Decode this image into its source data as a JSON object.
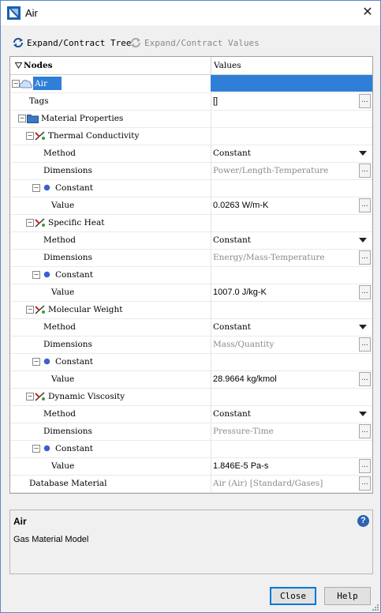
{
  "window": {
    "title": "Air",
    "close_glyph": "✕"
  },
  "toolbar": {
    "expand_tree_label": "Expand/Contract Tree",
    "expand_values_label": "Expand/Contract Values"
  },
  "grid": {
    "header": {
      "nodes": "Nodes",
      "values": "Values"
    },
    "rows": {
      "air": {
        "name": "Air",
        "value": ""
      },
      "tags": {
        "name": "Tags",
        "value": "[]",
        "button": "..."
      },
      "matprops": {
        "name": "Material Properties"
      },
      "thermal": {
        "name": "Thermal Conductivity"
      },
      "tc_method": {
        "name": "Method",
        "value": "Constant"
      },
      "tc_dims": {
        "name": "Dimensions",
        "value": "Power/Length-Temperature",
        "button": "..."
      },
      "tc_const": {
        "name": "Constant"
      },
      "tc_value": {
        "name": "Value",
        "value": "0.0263 W/m-K",
        "button": "..."
      },
      "specheat": {
        "name": "Specific Heat"
      },
      "sh_method": {
        "name": "Method",
        "value": "Constant"
      },
      "sh_dims": {
        "name": "Dimensions",
        "value": "Energy/Mass-Temperature",
        "button": "..."
      },
      "sh_const": {
        "name": "Constant"
      },
      "sh_value": {
        "name": "Value",
        "value": "1007.0 J/kg-K",
        "button": "..."
      },
      "molweight": {
        "name": "Molecular Weight"
      },
      "mw_method": {
        "name": "Method",
        "value": "Constant"
      },
      "mw_dims": {
        "name": "Dimensions",
        "value": "Mass/Quantity",
        "button": "..."
      },
      "mw_const": {
        "name": "Constant"
      },
      "mw_value": {
        "name": "Value",
        "value": "28.9664 kg/kmol",
        "button": "..."
      },
      "dynvisc": {
        "name": "Dynamic Viscosity"
      },
      "dv_method": {
        "name": "Method",
        "value": "Constant"
      },
      "dv_dims": {
        "name": "Dimensions",
        "value": "Pressure-Time",
        "button": "..."
      },
      "dv_const": {
        "name": "Constant"
      },
      "dv_value": {
        "name": "Value",
        "value": "1.846E-5 Pa-s",
        "button": "..."
      },
      "dbmat": {
        "name": "Database Material",
        "value": "Air (Air) [Standard/Gases]",
        "button": "..."
      }
    }
  },
  "description": {
    "title": "Air",
    "text": "Gas Material Model",
    "help_glyph": "?"
  },
  "buttons": {
    "close": "Close",
    "help": "Help"
  },
  "colors": {
    "selection": "#2f7fd8",
    "folder": "#3b78c4",
    "bullet": "#3e5fcf",
    "accent": "#0078d7"
  }
}
